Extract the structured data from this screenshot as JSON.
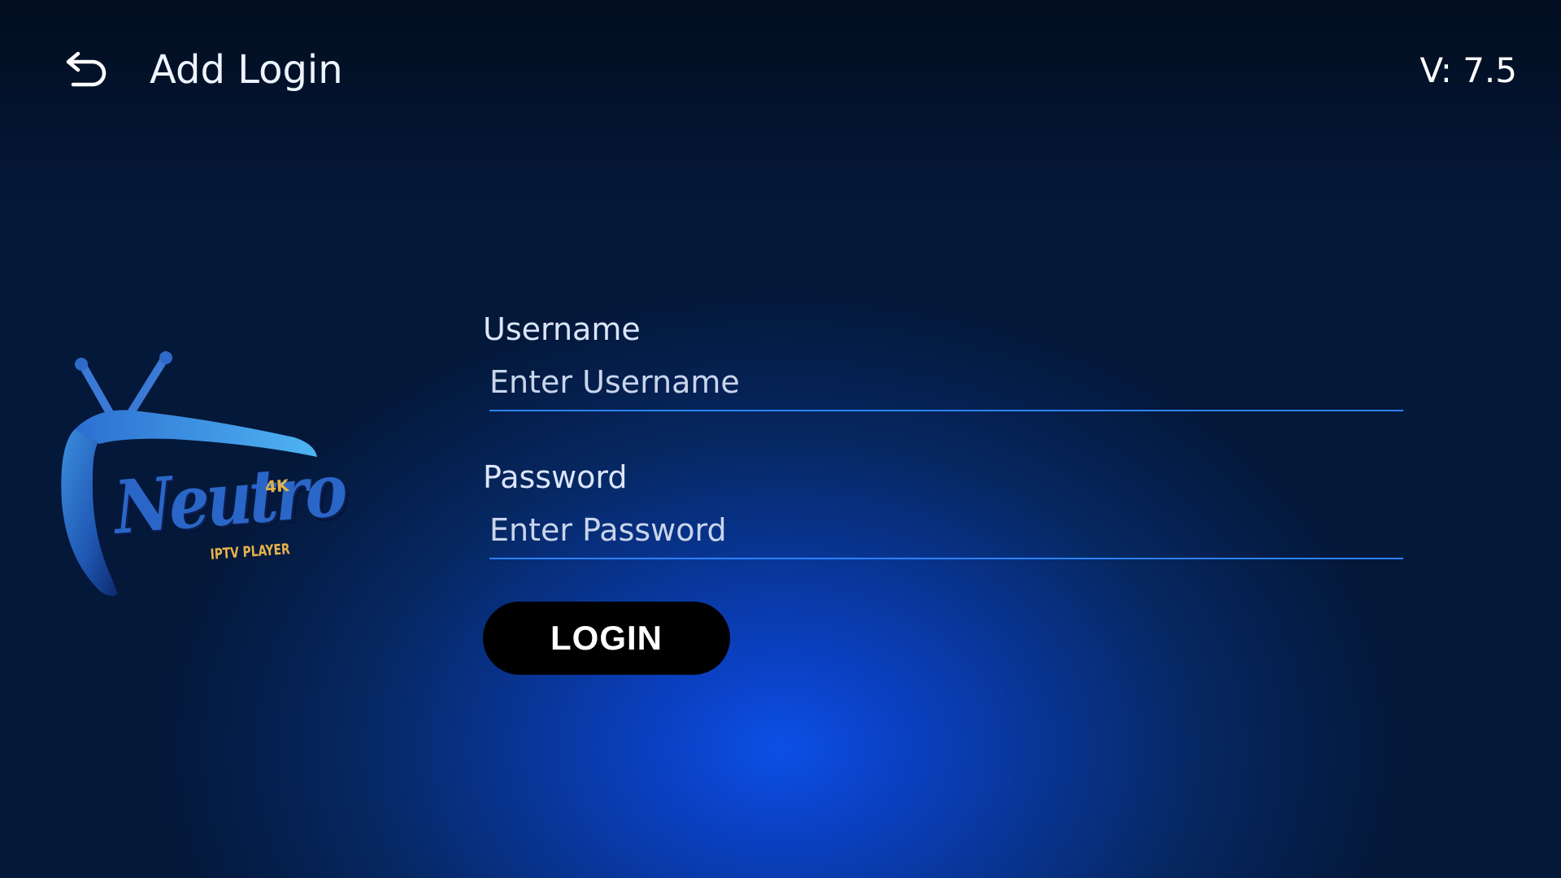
{
  "header": {
    "back_icon": "back-arrow-icon",
    "title": "Add Login",
    "version": "V: 7.5"
  },
  "logo": {
    "word": "Neutro",
    "badge": "4K",
    "tagline": "IPTV PLAYER"
  },
  "form": {
    "username_label": "Username",
    "username_placeholder": "Enter Username",
    "username_value": "",
    "password_label": "Password",
    "password_placeholder": "Enter Password",
    "password_value": "",
    "login_label": "LOGIN"
  },
  "colors": {
    "accent_underline": "#2d82ff",
    "button_bg": "#000000",
    "background_glow": "#0d4fe6",
    "logo_gold": "#e6b34a",
    "logo_blue": "#2a66c7"
  }
}
